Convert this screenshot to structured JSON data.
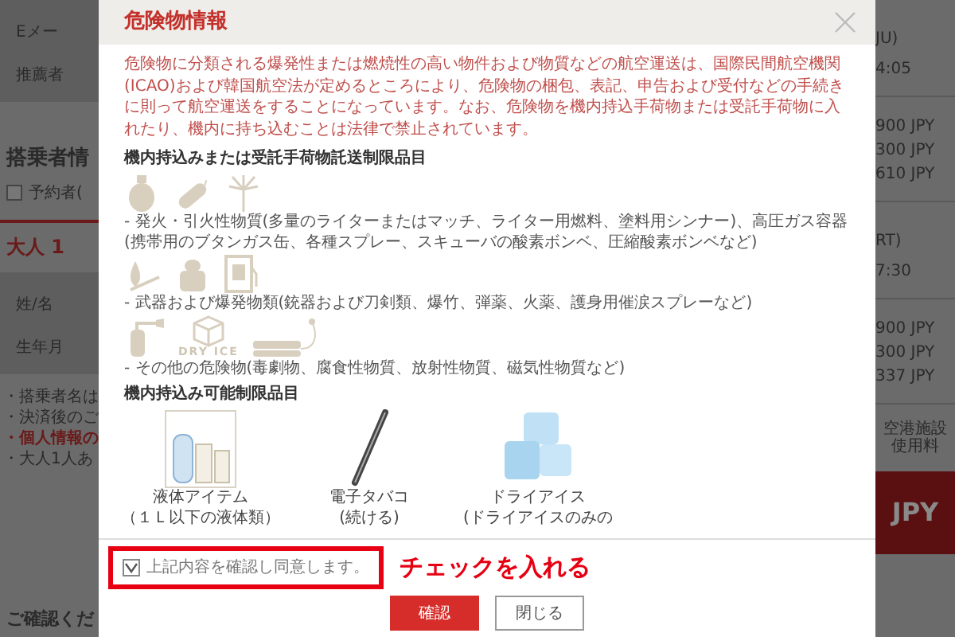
{
  "background": {
    "left": [
      {
        "kind": "panel",
        "texts": [
          {
            "text": "Eメー"
          },
          {
            "text": "推薦者"
          }
        ]
      },
      {
        "kind": "heading",
        "texts": [
          {
            "text": "搭乗者情"
          }
        ]
      },
      {
        "kind": "checkbox",
        "checked": false,
        "texts": [
          {
            "text": "予約者("
          }
        ]
      },
      {
        "kind": "tab",
        "texts": [
          {
            "text": "大人 1"
          }
        ]
      },
      {
        "kind": "panel",
        "texts": [
          {
            "text": "姓/名"
          },
          {
            "text": "生年月"
          }
        ]
      },
      {
        "kind": "bullets",
        "texts": [
          {
            "text": "・搭乗者名は",
            "emphasis": false
          },
          {
            "text": "・決済後のご",
            "emphasis": false
          },
          {
            "text": "・個人情報の",
            "emphasis": true
          },
          {
            "text": "・大人1人あ",
            "emphasis": false
          }
        ]
      },
      {
        "kind": "bold",
        "texts": [
          {
            "text": "ご確認くだ"
          }
        ]
      }
    ],
    "right": [
      {
        "kind": "times",
        "texts": [
          {
            "text": "JU)"
          },
          {
            "text": "4:05"
          }
        ]
      },
      {
        "kind": "fares",
        "texts": [
          {
            "text": "900 JPY"
          },
          {
            "text": "300 JPY"
          },
          {
            "text": "610 JPY"
          }
        ]
      },
      {
        "kind": "times",
        "texts": [
          {
            "text": "RT)"
          },
          {
            "text": "7:30"
          }
        ]
      },
      {
        "kind": "fares",
        "texts": [
          {
            "text": "900 JPY"
          },
          {
            "text": "300 JPY"
          },
          {
            "text": "337 JPY"
          }
        ]
      },
      {
        "kind": "note",
        "texts": [
          {
            "text": "空港施設"
          },
          {
            "text": "使用料"
          }
        ]
      },
      {
        "kind": "total",
        "texts": [
          {
            "text": "JPY"
          }
        ]
      }
    ]
  },
  "modal": {
    "title": "危険物情報",
    "intro": "危険物に分類される爆発性または燃焼性の高い物件および物質などの航空運送は、国際民間航空機関(ICAO)および韓国航空法が定めるところにより、危険物の梱包、表記、申告および受付などの手続きに則って航空運送をすることになっています。なお、危険物を機内持込手荷物または受託手荷物に入れたり、機内に持ち込むことは法律で禁止されています。",
    "restricted": {
      "heading": "機内持込みまたは受託手荷物託送制限品目",
      "groups": [
        {
          "caption": "- 発火・引火性物質(多量のライターまたはマッチ、ライター用燃料、塗料用シンナー)、高圧ガス容器(携帯用のブタンガス缶、各種スプレー、スキューバの酸素ボンベ、圧縮酸素ボンベなど)"
        },
        {
          "caption": "- 武器および爆発物類(銃器および刀剣類、爆竹、弾薬、火薬、護身用催涙スプレーなど)"
        },
        {
          "caption": "- その他の危険物(毒劇物、腐食性物質、放射性物質、磁気性物質など)",
          "icon_label": "DRY ICE"
        }
      ]
    },
    "allowed": {
      "heading": "機内持込み可能制限品目",
      "items": [
        {
          "name": "液体アイテム",
          "note": "（１Ｌ以下の液体類）"
        },
        {
          "name": "電子タバコ",
          "note": "(続ける)"
        },
        {
          "name": "ドライアイス",
          "note": "(ドライアイスのみの"
        }
      ]
    },
    "agreement": {
      "label": "上記内容を確認し同意します。",
      "checked": true
    },
    "annotation": "チェックを入れる",
    "buttons": [
      {
        "label": "確認",
        "kind": "primary"
      },
      {
        "label": "閉じる",
        "kind": "secondary"
      }
    ]
  }
}
